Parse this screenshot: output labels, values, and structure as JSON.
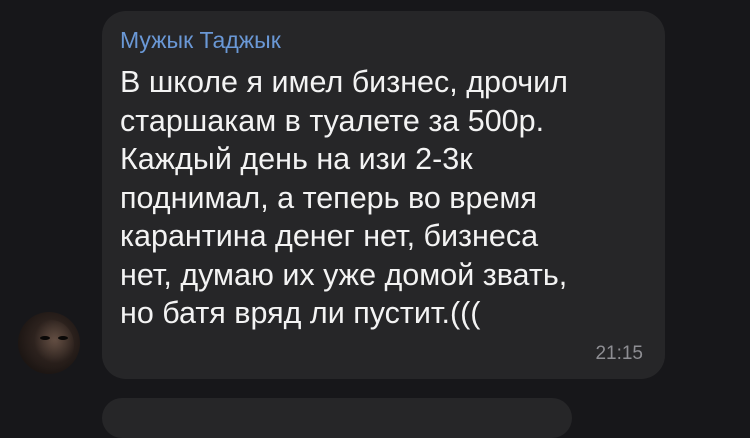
{
  "message": {
    "sender_name": "Мужык Таджык",
    "lines": [
      "В школе я имел бизнес, дрочил",
      "старшакам в туалете за 500р.",
      "Каждый день на изи 2-3к",
      "поднимал, а теперь во время",
      "карантина денег нет, бизнеса",
      "нет, думаю их уже домой звать,",
      "но батя вряд ли пустит.((("
    ],
    "time": "21:15"
  },
  "colors": {
    "background": "#17171a",
    "bubble": "#262628",
    "sender": "#6a98d6",
    "text": "#f3f3f3",
    "time": "#8e8e93"
  }
}
